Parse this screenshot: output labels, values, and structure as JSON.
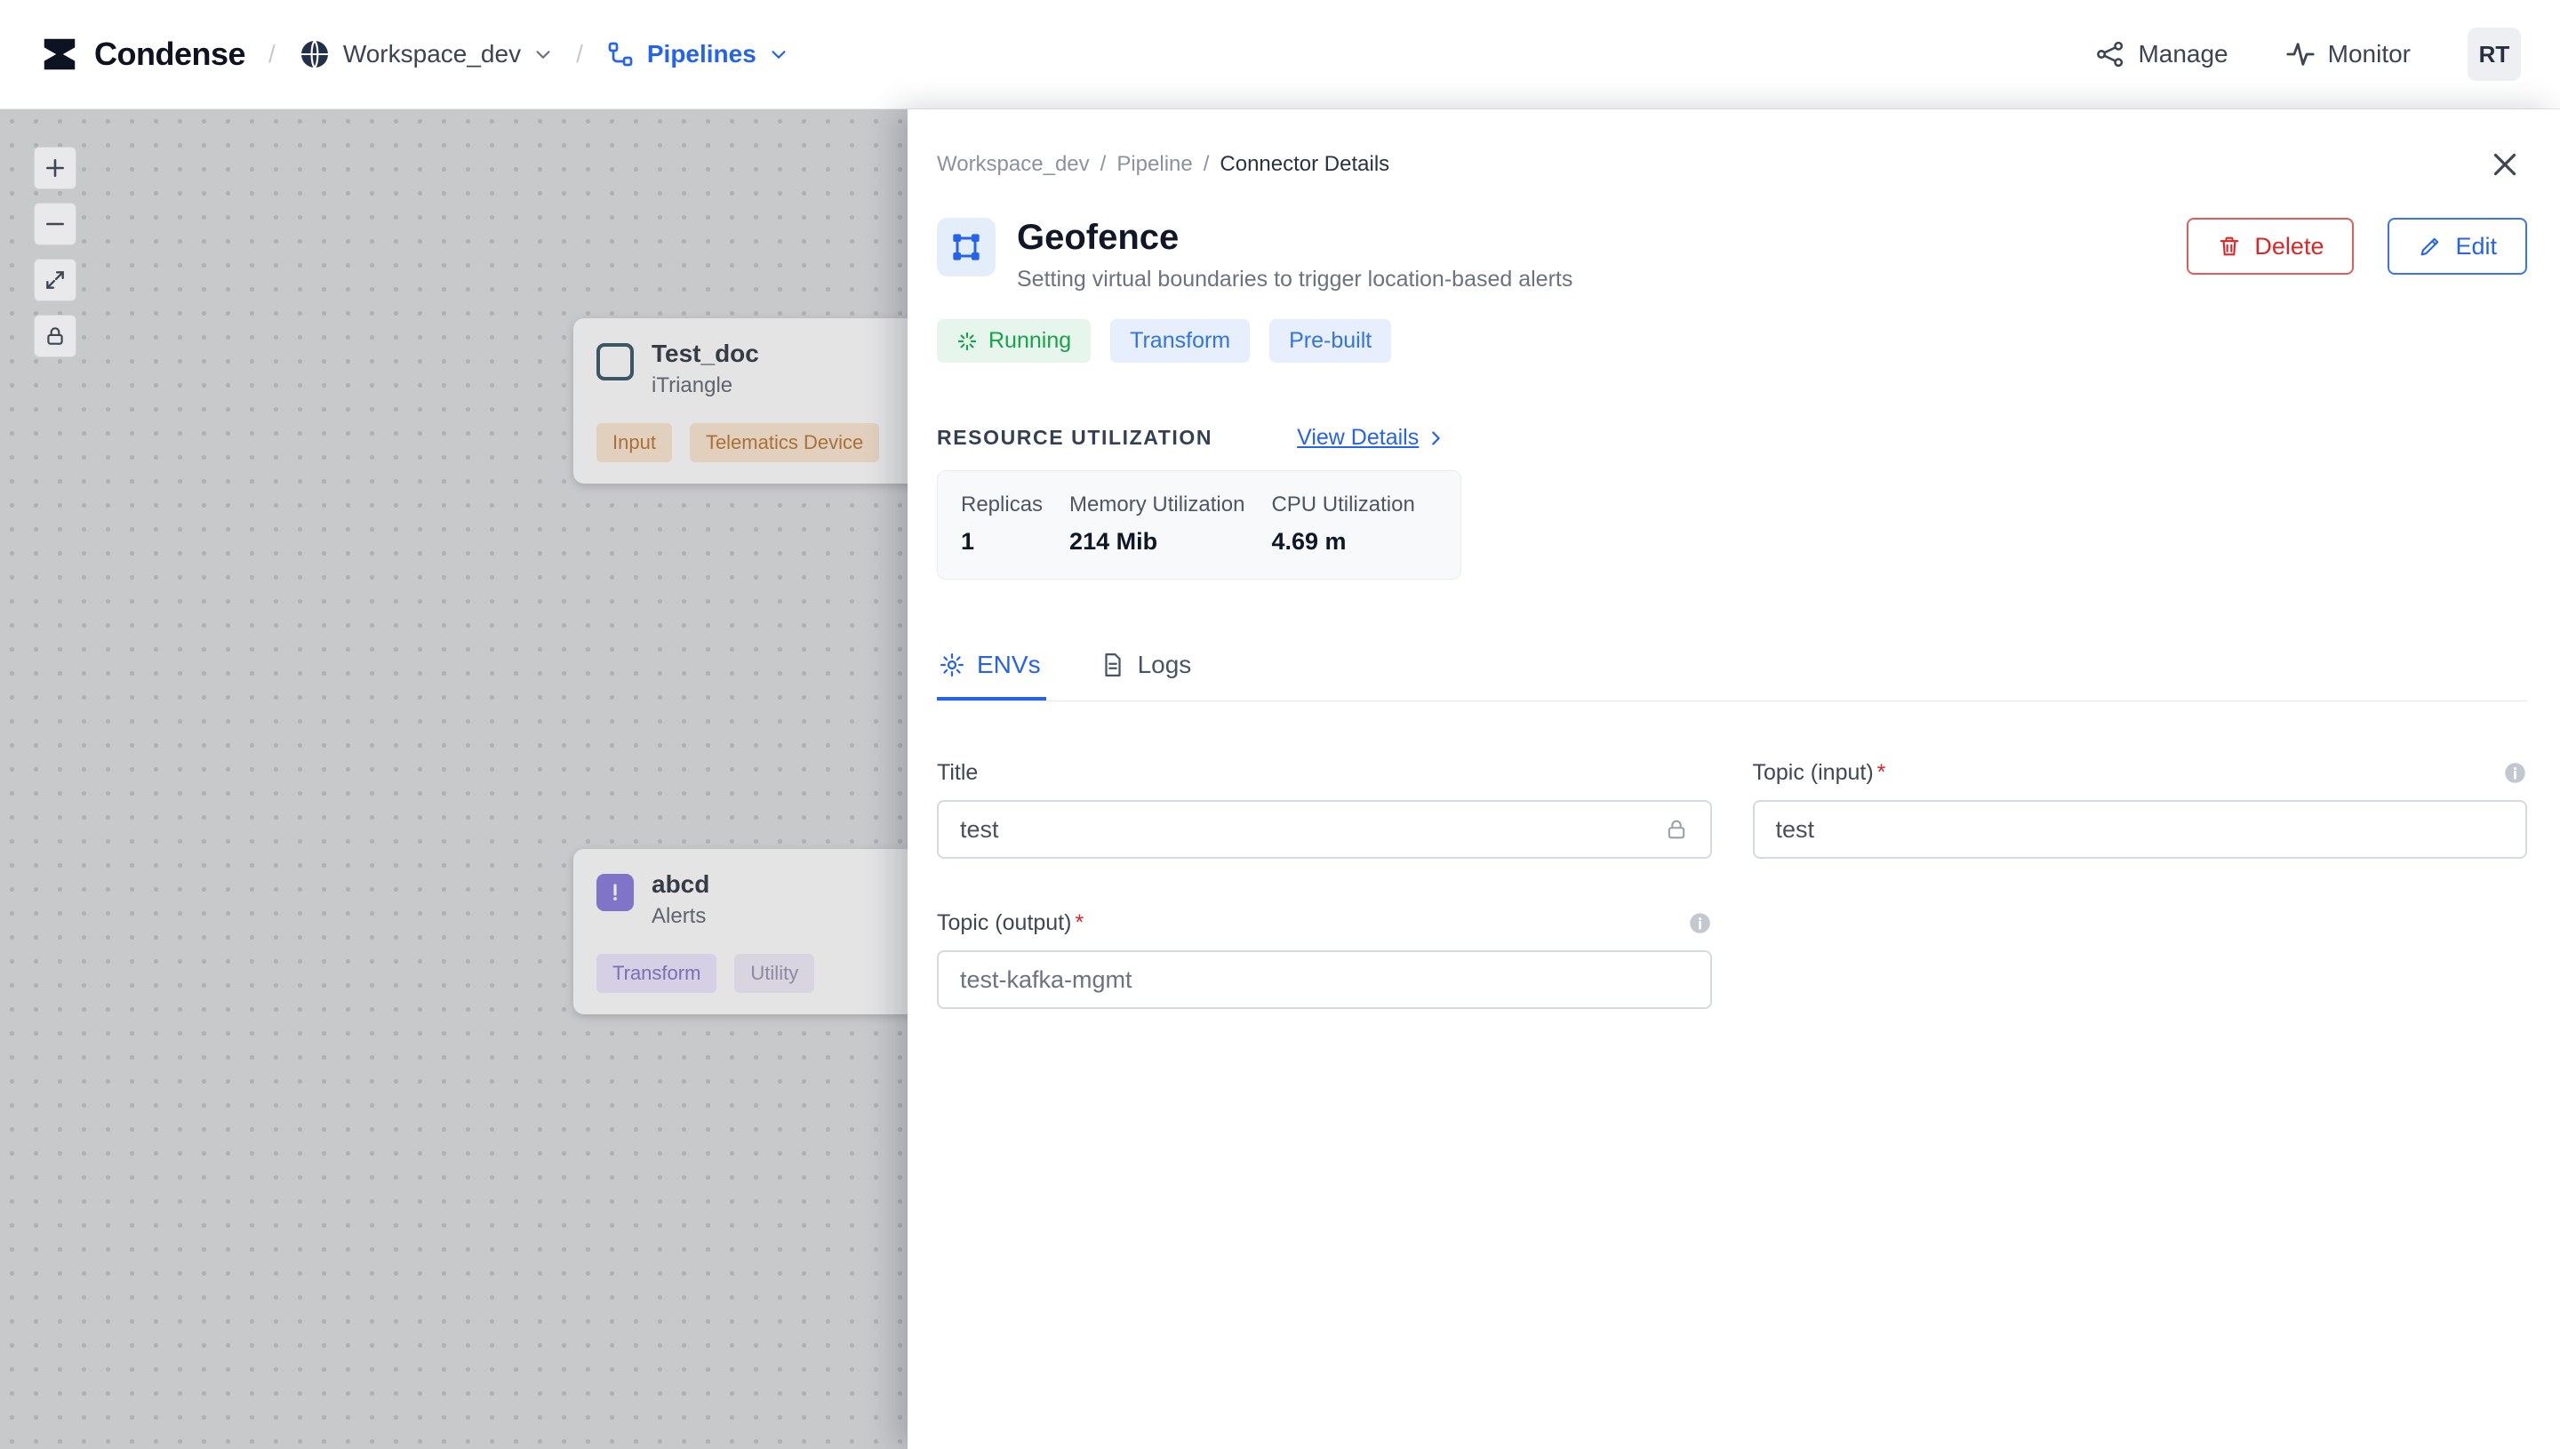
{
  "header": {
    "brand": "Condense",
    "separator": "/",
    "workspace_menu": "Workspace_dev",
    "pipelines_menu": "Pipelines",
    "manage": "Manage",
    "monitor": "Monitor",
    "avatar_initials": "RT"
  },
  "canvas": {
    "nodes": [
      {
        "title": "Test_doc",
        "subtitle": "iTriangle",
        "tags": [
          "Input",
          "Telematics Device"
        ]
      },
      {
        "title": "abcd",
        "subtitle": "Alerts",
        "tags": [
          "Transform",
          "Utility"
        ]
      }
    ]
  },
  "drawer": {
    "breadcrumb": {
      "workspace": "Workspace_dev",
      "pipeline": "Pipeline",
      "current": "Connector Details"
    },
    "title": "Geofence",
    "subtitle": "Setting virtual boundaries to trigger location-based alerts",
    "actions": {
      "delete": "Delete",
      "edit": "Edit"
    },
    "badges": [
      {
        "label": "Running"
      },
      {
        "label": "Transform"
      },
      {
        "label": "Pre-built"
      }
    ],
    "resource": {
      "heading": "RESOURCE UTILIZATION",
      "view_details": "View Details",
      "metrics": [
        {
          "label": "Replicas",
          "value": "1"
        },
        {
          "label": "Memory Utilization",
          "value": "214 Mib"
        },
        {
          "label": "CPU Utilization",
          "value": "4.69 m"
        }
      ]
    },
    "tabs": [
      {
        "label": "ENVs"
      },
      {
        "label": "Logs"
      }
    ],
    "form": {
      "title": {
        "label": "Title",
        "value": "test"
      },
      "topic_input": {
        "label": "Topic (input)",
        "required": "*",
        "value": "test"
      },
      "topic_output": {
        "label": "Topic (output)",
        "required": "*",
        "value": "test-kafka-mgmt"
      }
    }
  },
  "colors": {
    "accent_blue": "#2563eb",
    "danger_red": "#dc2626",
    "success_green": "#17a34a"
  }
}
